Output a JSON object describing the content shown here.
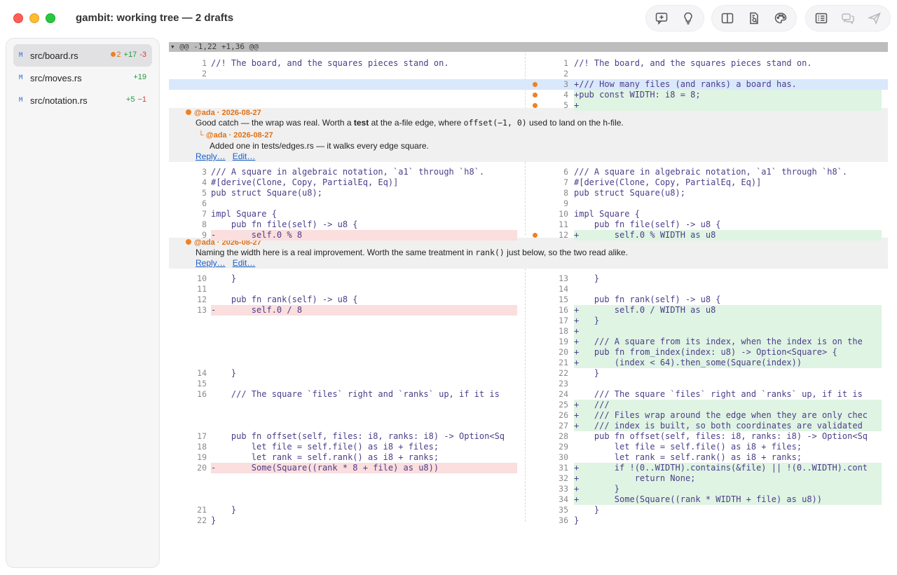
{
  "window": {
    "title": "gambit: working tree — 2 drafts"
  },
  "toolbar": {
    "group1": [
      "add-comment-icon",
      "lightbulb-icon"
    ],
    "group2": [
      "split-view-icon",
      "document-search-icon",
      "palette-icon"
    ],
    "group3": [
      "list-icon",
      "chat-bubbles-icon",
      "send-icon"
    ]
  },
  "sidebar": {
    "files": [
      {
        "status": "M",
        "name": "src/board.rs",
        "drafts": "2",
        "added": "+17",
        "removed": "-3",
        "active": true
      },
      {
        "status": "M",
        "name": "src/moves.rs",
        "drafts": "",
        "added": "+19",
        "removed": "",
        "active": false
      },
      {
        "status": "M",
        "name": "src/notation.rs",
        "drafts": "",
        "added": "+5",
        "removed": "−1",
        "active": false
      }
    ]
  },
  "diff": {
    "hunk": "▾ @@ -1,22 +1,36 @@",
    "rows": [
      {
        "t": 23,
        "ln": "1",
        "lc": "//! The board, and the squares pieces stand on.",
        "rn": "1",
        "rc": "//! The board, and the squares pieces stand on.",
        "rk": ""
      },
      {
        "t": 38,
        "ln": "2",
        "lc": "",
        "rn": "2",
        "rc": "",
        "rk": ""
      },
      {
        "t": 53,
        "ln": "",
        "lc": "",
        "rn": "3",
        "rc": "+/// How many files (and ranks) a board has.",
        "rk": "hi",
        "dot": true
      },
      {
        "t": 68,
        "ln": "",
        "lc": "",
        "rn": "4",
        "rc": "+pub const WIDTH: i8 = 8;",
        "rk": "add",
        "dot": true
      },
      {
        "t": 83,
        "ln": "",
        "lc": "",
        "rn": "5",
        "rc": "+",
        "rk": "add",
        "dot": true
      },
      {
        "t": 178,
        "ln": "3",
        "lc": "/// A square in algebraic notation, `a1` through `h8`.",
        "rn": "6",
        "rc": "/// A square in algebraic notation, `a1` through `h8`.",
        "rk": ""
      },
      {
        "t": 193,
        "ln": "4",
        "lc": "#[derive(Clone, Copy, PartialEq, Eq)]",
        "rn": "7",
        "rc": "#[derive(Clone, Copy, PartialEq, Eq)]",
        "rk": ""
      },
      {
        "t": 208,
        "ln": "5",
        "lc": "pub struct Square(u8);",
        "rn": "8",
        "rc": "pub struct Square(u8);",
        "rk": ""
      },
      {
        "t": 223,
        "ln": "6",
        "lc": "",
        "rn": "9",
        "rc": "",
        "rk": ""
      },
      {
        "t": 238,
        "ln": "7",
        "lc": "impl Square {",
        "rn": "10",
        "rc": "impl Square {",
        "rk": ""
      },
      {
        "t": 253,
        "ln": "8",
        "lc": "    pub fn file(self) -> u8 {",
        "rn": "11",
        "rc": "    pub fn file(self) -> u8 {",
        "rk": ""
      },
      {
        "t": 268,
        "ln": "9",
        "lc": "-       self.0 % 8",
        "lk": "del",
        "rn": "12",
        "rc": "+       self.0 % WIDTH as u8",
        "rk": "add",
        "dot": true
      },
      {
        "t": 330,
        "ln": "10",
        "lc": "    }",
        "rn": "13",
        "rc": "    }",
        "rk": ""
      },
      {
        "t": 345,
        "ln": "11",
        "lc": "",
        "rn": "14",
        "rc": "",
        "rk": ""
      },
      {
        "t": 360,
        "ln": "12",
        "lc": "    pub fn rank(self) -> u8 {",
        "rn": "15",
        "rc": "    pub fn rank(self) -> u8 {",
        "rk": ""
      },
      {
        "t": 375,
        "ln": "13",
        "lc": "-       self.0 / 8",
        "lk": "del",
        "rn": "16",
        "rc": "+       self.0 / WIDTH as u8",
        "rk": "add"
      },
      {
        "t": 390,
        "ln": "",
        "lc": "",
        "rn": "17",
        "rc": "+   }",
        "rk": "add"
      },
      {
        "t": 405,
        "ln": "",
        "lc": "",
        "rn": "18",
        "rc": "+",
        "rk": "add"
      },
      {
        "t": 420,
        "ln": "",
        "lc": "",
        "rn": "19",
        "rc": "+   /// A square from its index, when the index is on the",
        "rk": "add"
      },
      {
        "t": 435,
        "ln": "",
        "lc": "",
        "rn": "20",
        "rc": "+   pub fn from_index(index: u8) -> Option<Square> {",
        "rk": "add"
      },
      {
        "t": 450,
        "ln": "",
        "lc": "",
        "rn": "21",
        "rc": "+       (index < 64).then_some(Square(index))",
        "rk": "add"
      },
      {
        "t": 465,
        "ln": "14",
        "lc": "    }",
        "rn": "22",
        "rc": "    }",
        "rk": ""
      },
      {
        "t": 480,
        "ln": "15",
        "lc": "",
        "rn": "23",
        "rc": "",
        "rk": ""
      },
      {
        "t": 495,
        "ln": "16",
        "lc": "    /// The square `files` right and `ranks` up, if it is",
        "rn": "24",
        "rc": "    /// The square `files` right and `ranks` up, if it is",
        "rk": ""
      },
      {
        "t": 510,
        "ln": "",
        "lc": "",
        "rn": "25",
        "rc": "+   ///",
        "rk": "add"
      },
      {
        "t": 525,
        "ln": "",
        "lc": "",
        "rn": "26",
        "rc": "+   /// Files wrap around the edge when they are only chec",
        "rk": "add"
      },
      {
        "t": 540,
        "ln": "",
        "lc": "",
        "rn": "27",
        "rc": "+   /// index is built, so both coordinates are validated",
        "rk": "add"
      },
      {
        "t": 555,
        "ln": "17",
        "lc": "    pub fn offset(self, files: i8, ranks: i8) -> Option<Sq",
        "rn": "28",
        "rc": "    pub fn offset(self, files: i8, ranks: i8) -> Option<Sq",
        "rk": ""
      },
      {
        "t": 570,
        "ln": "18",
        "lc": "        let file = self.file() as i8 + files;",
        "rn": "29",
        "rc": "        let file = self.file() as i8 + files;",
        "rk": ""
      },
      {
        "t": 585,
        "ln": "19",
        "lc": "        let rank = self.rank() as i8 + ranks;",
        "rn": "30",
        "rc": "        let rank = self.rank() as i8 + ranks;",
        "rk": ""
      },
      {
        "t": 600,
        "ln": "20",
        "lc": "-       Some(Square((rank * 8 + file) as u8))",
        "lk": "del",
        "rn": "31",
        "rc": "+       if !(0..WIDTH).contains(&file) || !(0..WIDTH).cont",
        "rk": "add"
      },
      {
        "t": 615,
        "ln": "",
        "lc": "",
        "rn": "32",
        "rc": "+           return None;",
        "rk": "add"
      },
      {
        "t": 630,
        "ln": "",
        "lc": "",
        "rn": "33",
        "rc": "+       }",
        "rk": "add"
      },
      {
        "t": 645,
        "ln": "",
        "lc": "",
        "rn": "34",
        "rc": "+       Some(Square((rank * WIDTH + file) as u8))",
        "rk": "add"
      },
      {
        "t": 660,
        "ln": "21",
        "lc": "    }",
        "rn": "35",
        "rc": "    }",
        "rk": ""
      },
      {
        "t": 675,
        "ln": "22",
        "lc": "}",
        "rn": "36",
        "rc": "}",
        "rk": ""
      }
    ]
  },
  "threads": [
    {
      "author": "@ada · 2026-08-27",
      "body_pre": "Good catch — the wrap was real. Worth a ",
      "body_bold": "test",
      "body_mid": " at the a-file edge, where ",
      "body_code": "offset(−1, 0)",
      "body_post": " used to land on the h-file.",
      "reply_author": "└ @ada · 2026-08-27",
      "reply_body": "Added one in tests/edges.rs — it walks every edge square.",
      "reply_link": "Reply…",
      "edit_link": "Edit…"
    },
    {
      "author": "@ada · 2026-08-27",
      "body_pre": "Naming the width here is a real improvement. Worth the same treatment in ",
      "body_code": "rank()",
      "body_post": " just below, so the two read alike.",
      "reply_link": "Reply…",
      "edit_link": "Edit…"
    }
  ],
  "colors": {
    "added": "#1f9a3c",
    "removed": "#d83b3b",
    "draft": "#f08022",
    "link": "#1a5fc8"
  }
}
